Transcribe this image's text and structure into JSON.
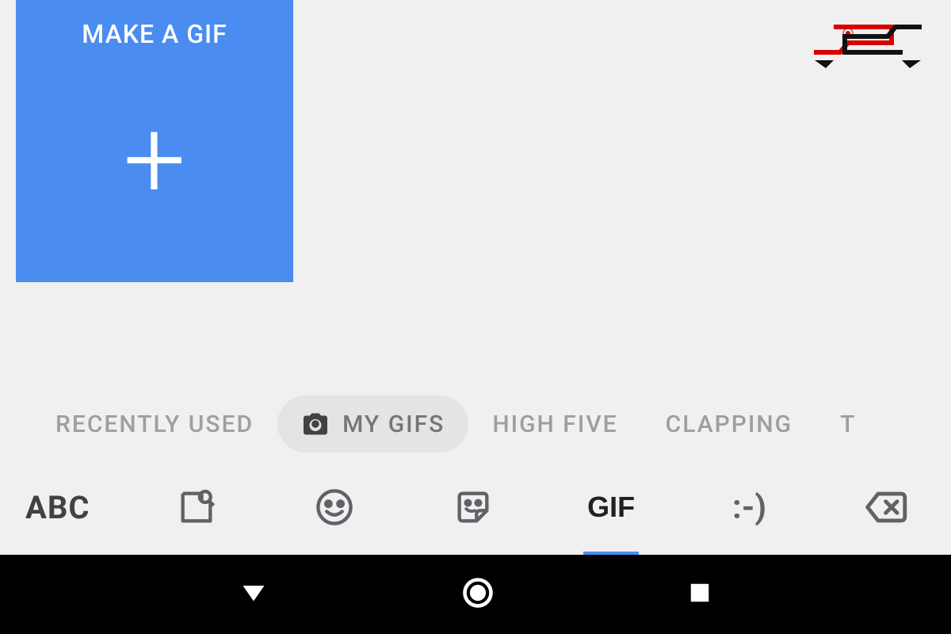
{
  "gif_tile": {
    "title": "MAKE A GIF",
    "plus": "+"
  },
  "categories": {
    "items": [
      {
        "label": "RECENTLY USED",
        "active": false
      },
      {
        "label": "MY GIFS",
        "active": true,
        "icon": "camera"
      },
      {
        "label": "HIGH FIVE",
        "active": false
      },
      {
        "label": "CLAPPING",
        "active": false
      },
      {
        "label": "T",
        "active": false
      }
    ]
  },
  "toolbar": {
    "abc": "ABC",
    "gif": "GIF",
    "emoticon": ":-)",
    "active_tab": "gif"
  },
  "watermark": {
    "brand": "S"
  }
}
